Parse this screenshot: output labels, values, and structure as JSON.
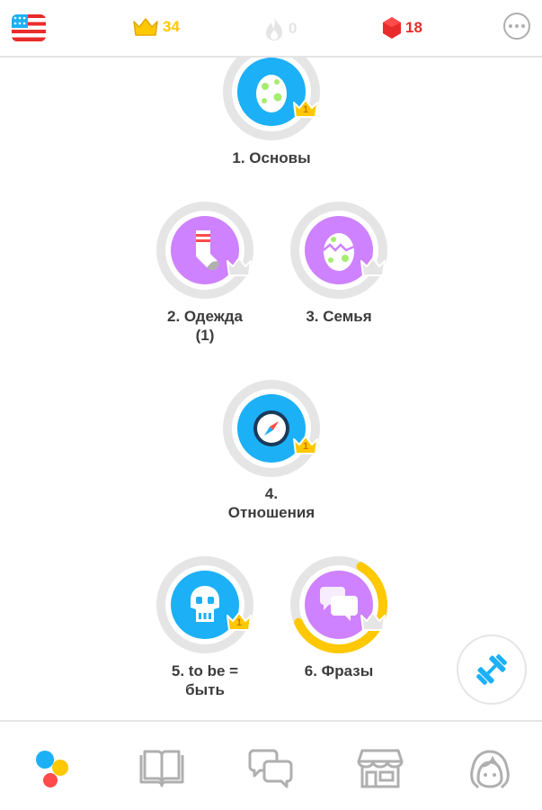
{
  "header": {
    "crowns": "34",
    "streak": "0",
    "gems": "18",
    "colors": {
      "crown": "#ffc800",
      "streak_inactive": "#e5e5e5",
      "gem": "#ea2b2b"
    }
  },
  "skills": [
    {
      "label_lines": [
        "1. Основы"
      ],
      "icon": "egg-icon",
      "crown_level": "1",
      "color": "#1cb0f6"
    },
    {
      "label_lines": [
        "2. Одежда",
        "(1)"
      ],
      "icon": "sock-icon",
      "crown_level": "",
      "color": "#ce82ff"
    },
    {
      "label_lines": [
        "3. Семья"
      ],
      "icon": "hatching-egg-icon",
      "crown_level": "",
      "color": "#ce82ff"
    },
    {
      "label_lines": [
        "4.",
        "Отношения"
      ],
      "icon": "compass-icon",
      "crown_level": "1",
      "color": "#1cb0f6"
    },
    {
      "label_lines": [
        "5. to be =",
        "быть"
      ],
      "icon": "skull-icon",
      "crown_level": "1",
      "color": "#1cb0f6"
    },
    {
      "label_lines": [
        "6. Фразы"
      ],
      "icon": "speech-bubbles-icon",
      "crown_level": "",
      "color": "#ce82ff",
      "progress": 0.6
    }
  ],
  "fab": {
    "icon": "dumbbell-icon"
  },
  "bottom_nav": [
    {
      "name": "learn",
      "icon": "learn-dots-icon",
      "active": true
    },
    {
      "name": "stories",
      "icon": "book-icon",
      "active": false
    },
    {
      "name": "discussion",
      "icon": "chat-bubbles-icon",
      "active": false
    },
    {
      "name": "shop",
      "icon": "shop-icon",
      "active": false
    },
    {
      "name": "profile",
      "icon": "profile-icon",
      "active": false
    }
  ]
}
